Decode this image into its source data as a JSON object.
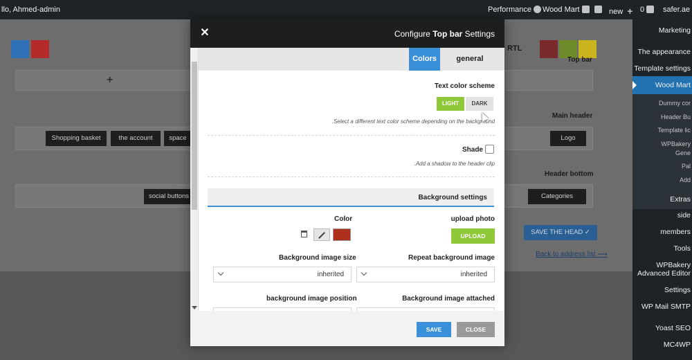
{
  "adminbar": {
    "greeting": "llo, Ahmed-admin",
    "items": [
      {
        "label": "Performance",
        "icon": "performance-icon"
      },
      {
        "label": "Wood Mart",
        "icon": "woodmart-icon"
      },
      {
        "label": "",
        "icon": "yoast-icon"
      },
      {
        "label": "new",
        "icon": "plus-icon"
      },
      {
        "label": "0",
        "icon": "comment-icon"
      },
      {
        "label": "safer.ae",
        "icon": ""
      }
    ]
  },
  "sidebar": {
    "items": [
      {
        "label": "Marketing"
      },
      {
        "label": "The appearance"
      },
      {
        "label": "Template settings"
      },
      {
        "label": "Wood Mart"
      },
      {
        "label": "Extras"
      },
      {
        "label": "side"
      },
      {
        "label": "members"
      },
      {
        "label": "Tools"
      },
      {
        "label": "WPBakery"
      },
      {
        "label": "Advanced Editor"
      },
      {
        "label": "Settings"
      },
      {
        "label": "WP Mail SMTP"
      },
      {
        "label": "Yoast SEO"
      },
      {
        "label": "MC4WP"
      }
    ],
    "subitems": [
      {
        "label": "Dummy cor"
      },
      {
        "label": "Header Bu"
      },
      {
        "label": "Template lic"
      },
      {
        "label": "WPBakery"
      },
      {
        "label": "Gene"
      },
      {
        "label": "Pal"
      },
      {
        "label": "Add"
      }
    ]
  },
  "builder": {
    "rtl_label": "RTL",
    "top_bar_label": "Top bar",
    "main_header_label": "Main header",
    "header_bottom_label": "Header bottom",
    "elements": {
      "shopping_basket": "Shopping basket",
      "account": "the account",
      "space": "space",
      "logo": "Logo",
      "social_buttons": "social buttons",
      "categories": "Categories"
    },
    "save_head": "SAVE THE HEAD ✓",
    "back_link": "Back to address list ⟶",
    "accent_colors": [
      "#2e6fb5",
      "#b52a2a",
      "#7a2a2a",
      "#6e8a2a",
      "#c9b41e"
    ]
  },
  "modal": {
    "title_prefix": "Configure",
    "title_bold": "Top bar",
    "title_suffix": "Settings",
    "tabs": {
      "colors": "Colors",
      "general": "general"
    },
    "text_color_scheme": {
      "label": "Text color scheme",
      "light": "LIGHT",
      "dark": "DARK",
      "selected": "LIGHT",
      "desc": ".Select a different text color scheme depending on the background"
    },
    "shade": {
      "label": "Shade",
      "checked": false,
      "desc": ".Add a shadow to the header clip"
    },
    "background_settings": "Background settings",
    "color": {
      "label": "Color",
      "value": "#b0301e"
    },
    "upload_photo": {
      "label": "upload photo",
      "button": "UPLOAD"
    },
    "bg_image_size": {
      "label": "Background image size",
      "value": "inherited"
    },
    "repeat_bg_image": {
      "label": "Repeat background image",
      "value": "inherited"
    },
    "bg_image_position": {
      "label": "background image position"
    },
    "bg_image_attached": {
      "label": "Background image attached"
    },
    "save": "SAVE",
    "close": "CLOSE"
  }
}
